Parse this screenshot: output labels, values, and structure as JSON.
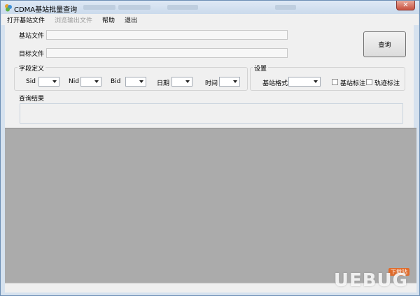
{
  "window": {
    "title": "CDMA基站批量查询",
    "close_glyph": "✕",
    "icon": "app-icon"
  },
  "menu": [
    {
      "label": "打开基站文件",
      "disabled": false
    },
    {
      "label": "浏览输出文件",
      "disabled": true
    },
    {
      "label": "帮助",
      "disabled": false
    },
    {
      "label": "退出",
      "disabled": false
    }
  ],
  "form": {
    "base_file_label": "基站文件",
    "base_file_value": "",
    "target_file_label": "目标文件",
    "target_file_value": "",
    "query_button": "查询"
  },
  "field_def": {
    "title": "字段定义",
    "sid_label": "Sid",
    "nid_label": "Nid",
    "bid_label": "Bid",
    "date_label": "日期",
    "time_label": "时间"
  },
  "settings": {
    "title": "设置",
    "format_label": "基站格式",
    "station_mark_label": "基站标注",
    "track_mark_label": "轨迹标注",
    "station_mark_checked": false,
    "track_mark_checked": false
  },
  "results": {
    "label": "查询结果",
    "value": ""
  },
  "watermark": {
    "text": "UEBUG",
    "badge": "下载站"
  }
}
